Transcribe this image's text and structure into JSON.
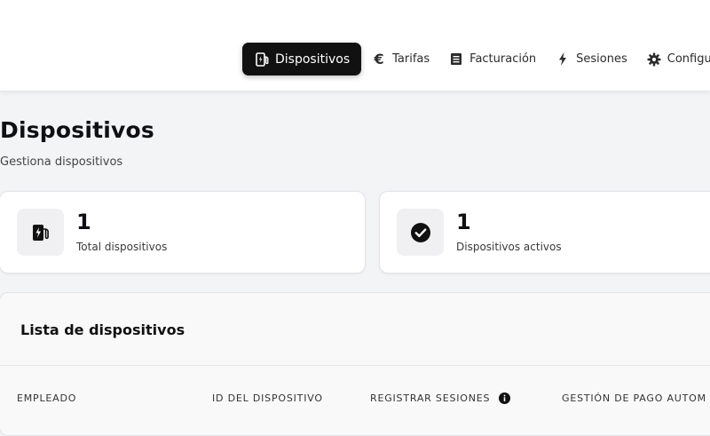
{
  "nav": {
    "items": [
      {
        "label": "Dispositivos",
        "icon": "charger-icon",
        "active": true
      },
      {
        "label": "Tarifas",
        "icon": "euro-icon",
        "active": false
      },
      {
        "label": "Facturación",
        "icon": "document-icon",
        "active": false
      },
      {
        "label": "Sesiones",
        "icon": "lightning-icon",
        "active": false
      },
      {
        "label": "Configu",
        "icon": "gear-icon",
        "active": false
      }
    ]
  },
  "page": {
    "title": "Dispositivos",
    "subtitle": "Gestiona dispositivos"
  },
  "stats": [
    {
      "value": "1",
      "label": "Total dispositivos",
      "icon": "charger-icon"
    },
    {
      "value": "1",
      "label": "Dispositivos activos",
      "icon": "check-circle-icon"
    }
  ],
  "list": {
    "title": "Lista de dispositivos",
    "columns": [
      "EMPLEADO",
      "ID DEL DISPOSITIVO",
      "REGISTRAR SESIONES",
      "GESTIÓN DE PAGO AUTOM"
    ]
  },
  "colors": {
    "active_nav_bg": "#111111",
    "page_bg": "#f3f4f6",
    "card_bg": "#ffffff"
  }
}
